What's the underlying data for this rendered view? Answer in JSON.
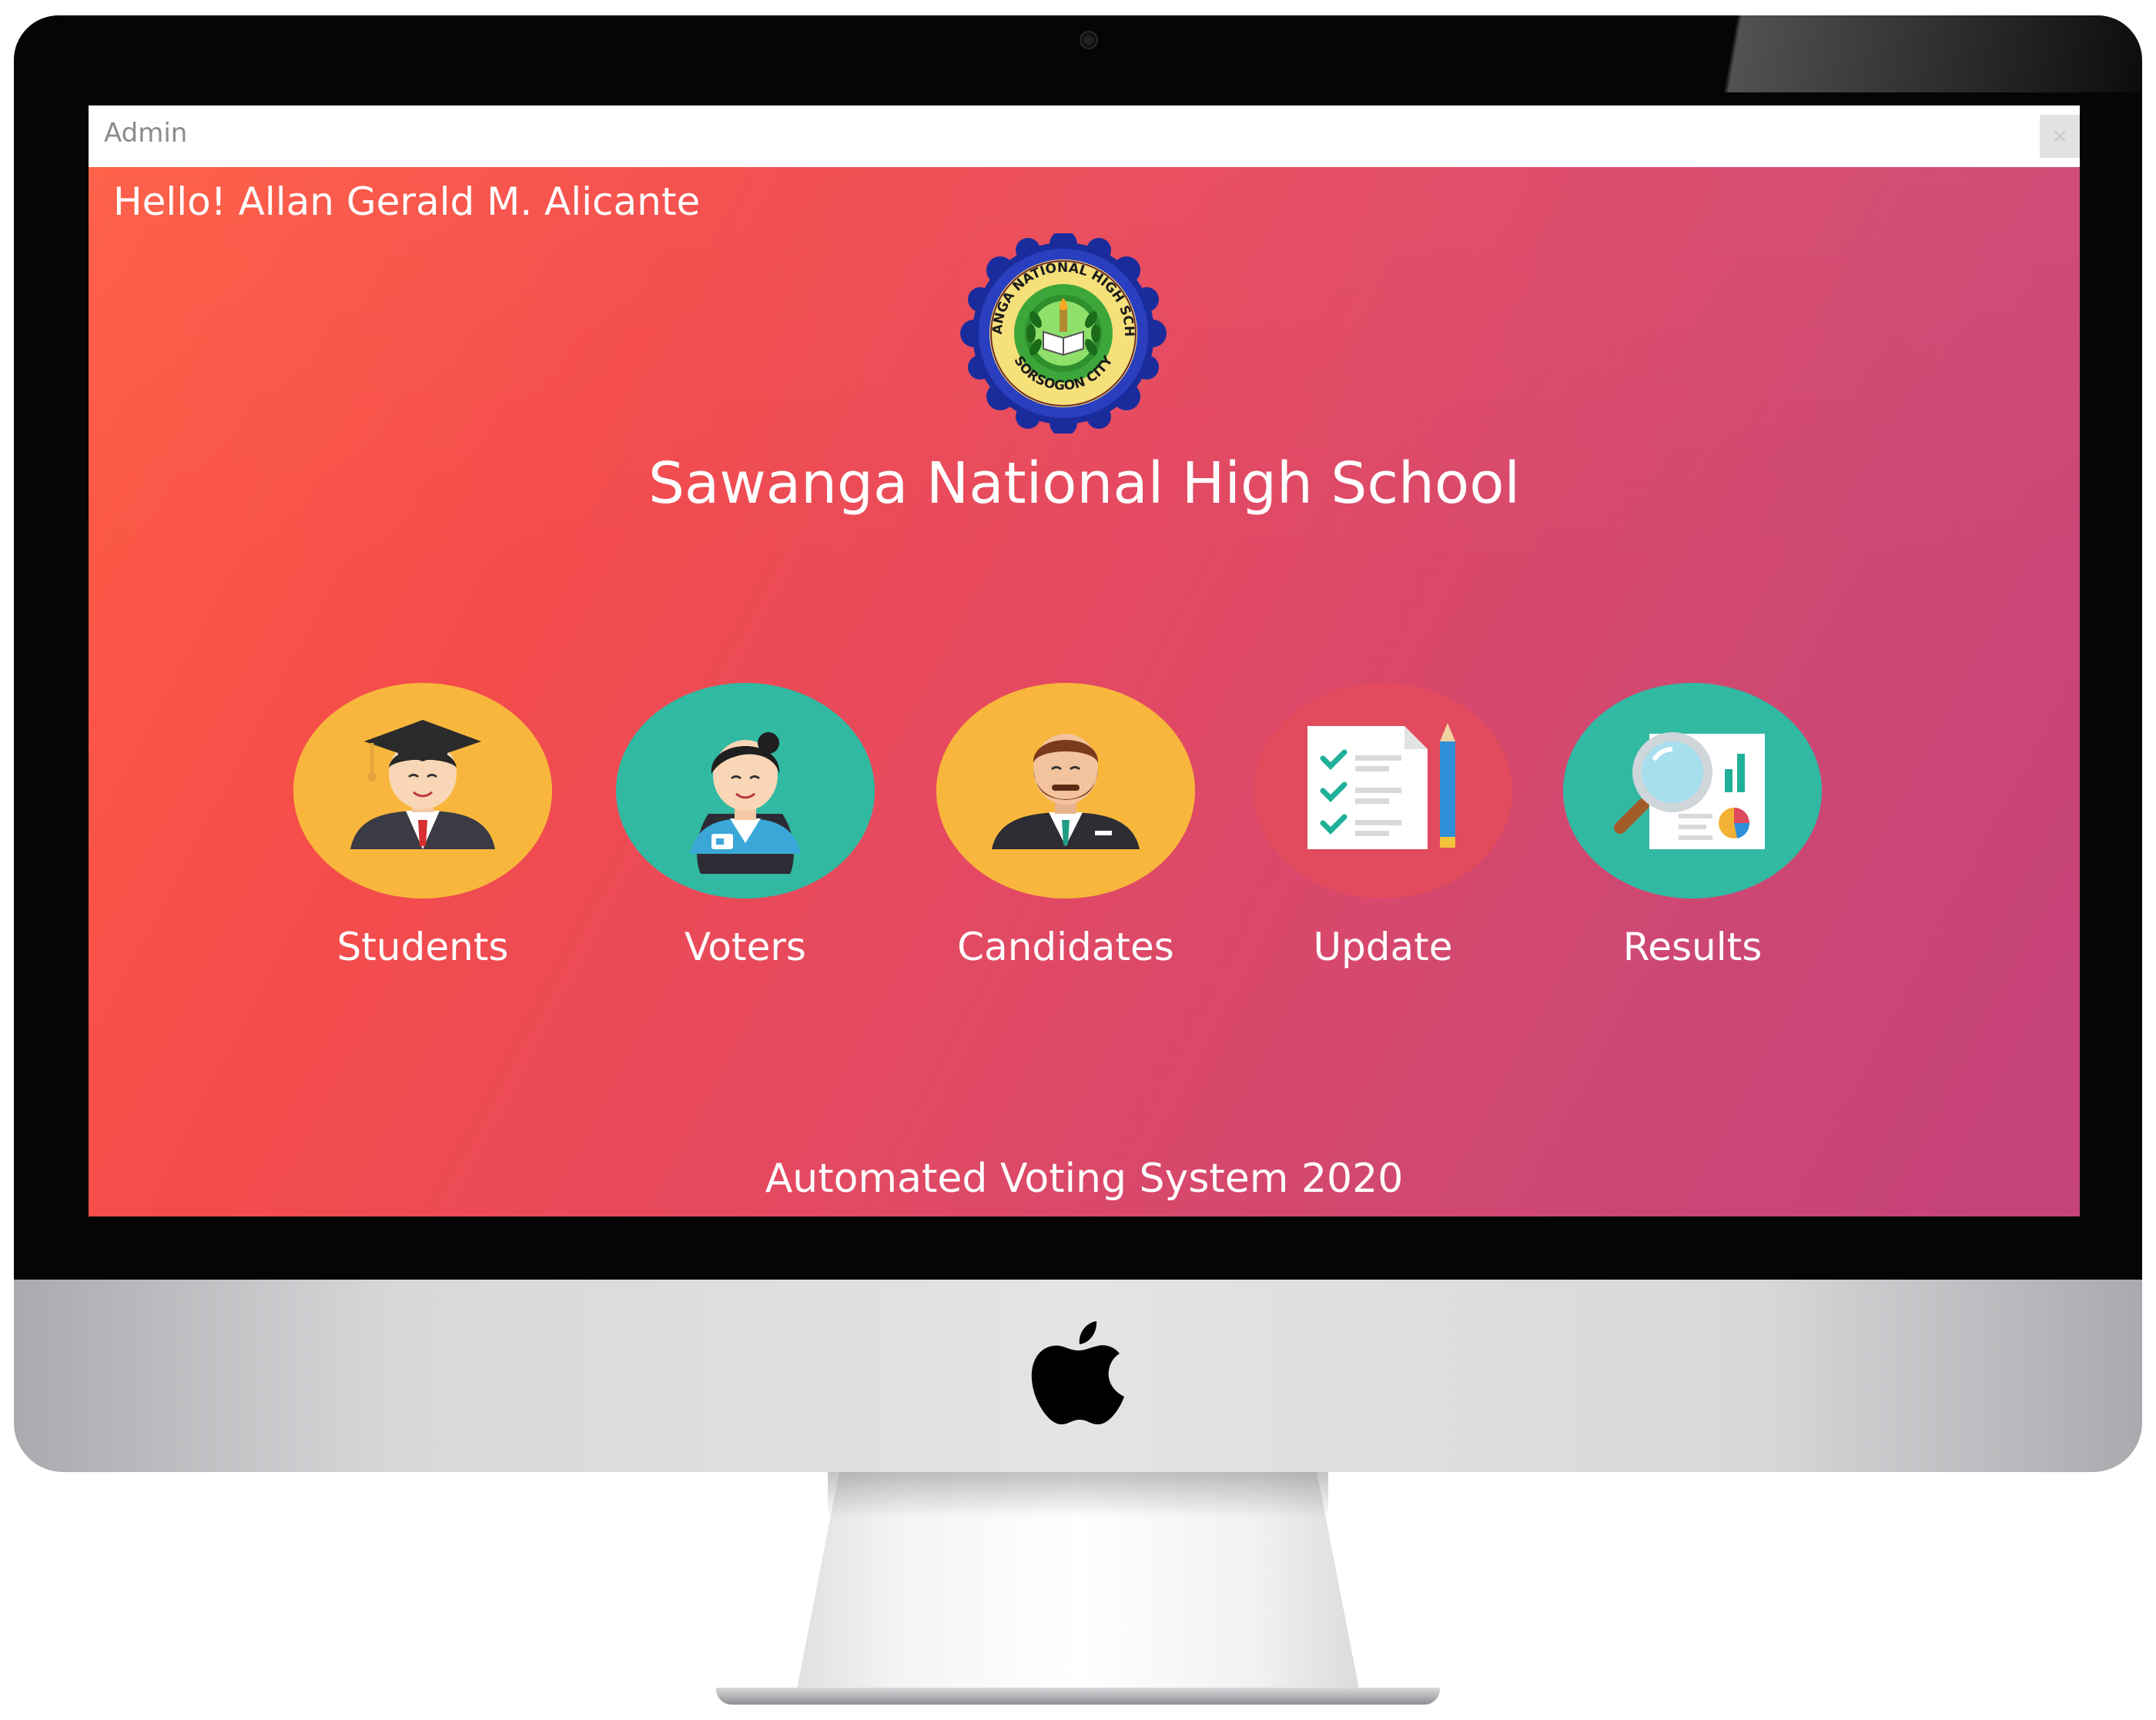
{
  "window": {
    "title": "Admin",
    "close_label": "×"
  },
  "greeting": "Hello! Allan Gerald M. Alicante",
  "logo": {
    "top_text": "SAWANGA NATIONAL HIGH SCHOOL",
    "bottom_text": "SORSOGON CITY"
  },
  "school_name": "Sawanga National High School",
  "menu": [
    {
      "label": "Students",
      "icon": "graduate-student-icon",
      "circle_color": "#f8b73c"
    },
    {
      "label": "Voters",
      "icon": "voter-woman-icon",
      "circle_color": "#31b9a2"
    },
    {
      "label": "Candidates",
      "icon": "candidate-man-icon",
      "circle_color": "#f8b73c"
    },
    {
      "label": "Update",
      "icon": "checklist-pencil-icon",
      "circle_color": "#e24a5d"
    },
    {
      "label": "Results",
      "icon": "magnifier-report-icon",
      "circle_color": "#31b9a2"
    }
  ],
  "footer": "Automated Voting System 2020"
}
